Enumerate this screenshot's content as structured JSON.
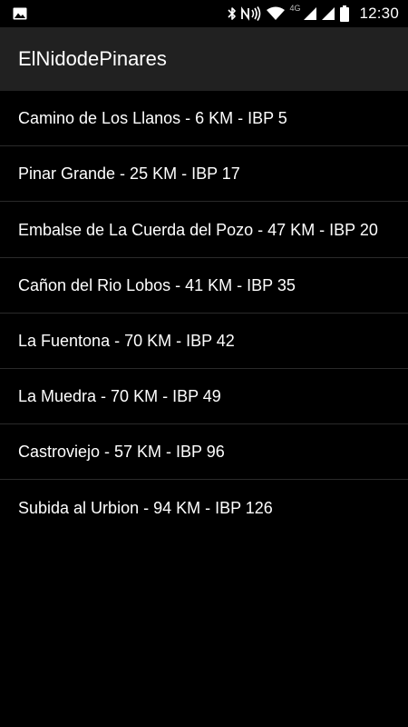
{
  "status_bar": {
    "time": "12:30",
    "network_label": "4G",
    "icons": [
      "image-icon",
      "bluetooth-icon",
      "nfc-icon",
      "wifi-icon",
      "signal-icon",
      "signal-icon",
      "battery-icon"
    ]
  },
  "app_bar": {
    "title": "ElNidodePinares"
  },
  "routes": [
    {
      "label": "Camino de Los Llanos - 6 KM - IBP 5"
    },
    {
      "label": "Pinar Grande - 25 KM - IBP 17"
    },
    {
      "label": "Embalse de La Cuerda del Pozo - 47 KM - IBP 20"
    },
    {
      "label": "Cañon del Rio Lobos - 41 KM - IBP 35"
    },
    {
      "label": "La Fuentona - 70 KM - IBP 42"
    },
    {
      "label": "La Muedra - 70 KM - IBP 49"
    },
    {
      "label": "Castroviejo - 57 KM - IBP 96"
    },
    {
      "label": "Subida al Urbion - 94 KM - IBP 126"
    }
  ],
  "colors": {
    "background": "#000000",
    "app_bar": "#212121",
    "divider": "#2a2a2a",
    "text": "#ffffff"
  }
}
